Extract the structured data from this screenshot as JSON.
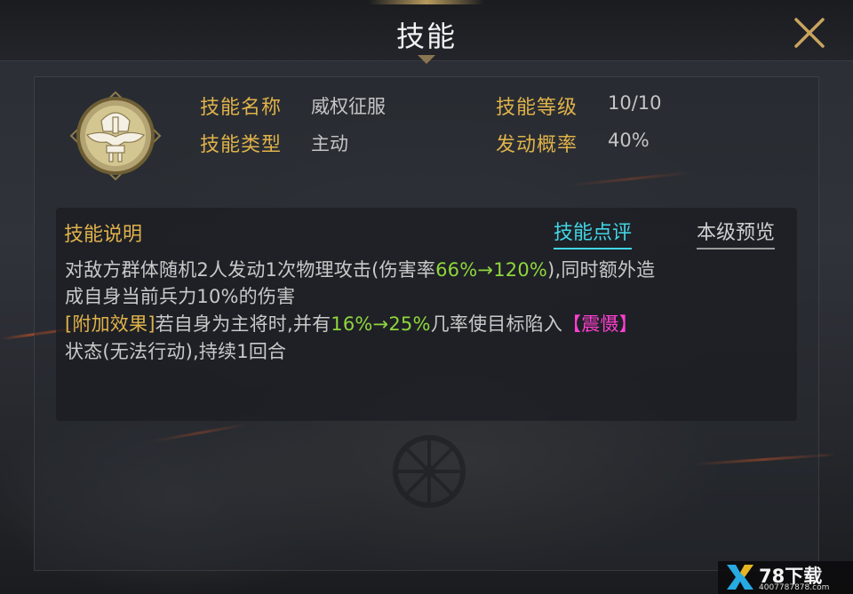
{
  "window": {
    "title": "技能"
  },
  "skill": {
    "icon": "knight-helmet-emblem-icon",
    "name_label": "技能名称",
    "name_value": "威权征服",
    "level_label": "技能等级",
    "level_value": "10/10",
    "type_label": "技能类型",
    "type_value": "主动",
    "chance_label": "发动概率",
    "chance_value": "40%"
  },
  "description": {
    "title": "技能说明",
    "tabs": [
      {
        "label": "技能点评",
        "active": true
      },
      {
        "label": "本级预览",
        "active": false
      }
    ],
    "line1": {
      "a": "对敌方群体随机2人发动1次物理攻击(伤害率",
      "b": "66%→120%",
      "c": "),同时额外造"
    },
    "line2": "成自身当前兵力10%的伤害",
    "line3": {
      "a": "[附加效果]",
      "b": "若自身为主将时,并有",
      "c": "16%→25%",
      "d": "几率使目标陷入",
      "e": "【震慑】"
    },
    "line4": "状态(无法行动),持续1回合"
  },
  "watermark": {
    "brand": "78下载",
    "url": "4007787878.com"
  },
  "colors": {
    "label_gold": "#e0b24a",
    "value_green": "#8fd63c",
    "status_pink": "#ff3fd0",
    "tab_active_cyan": "#42d6e6"
  }
}
